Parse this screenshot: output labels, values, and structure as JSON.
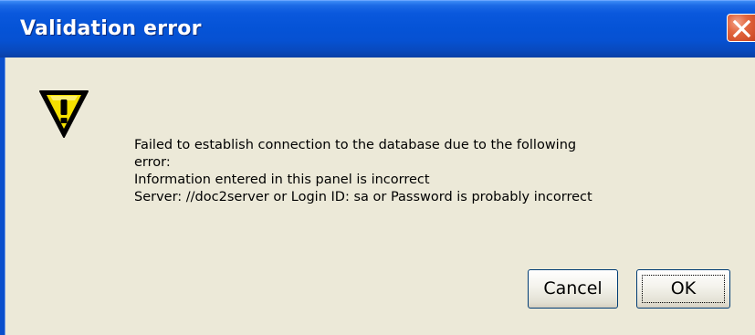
{
  "dialog": {
    "title": "Validation error",
    "icon": "warning-icon",
    "message_lines": [
      "Failed to establish connection to the database due to the following",
      "error:",
      "Information entered in this panel is incorrect",
      "Server: //doc2server or Login ID: sa or Password is probably incorrect"
    ],
    "buttons": {
      "cancel_label": "Cancel",
      "ok_label": "OK"
    },
    "colors": {
      "titlebar": "#0553d6",
      "body": "#ece9d8",
      "close_button": "#e2663f",
      "warning_fill": "#f5e100"
    }
  }
}
